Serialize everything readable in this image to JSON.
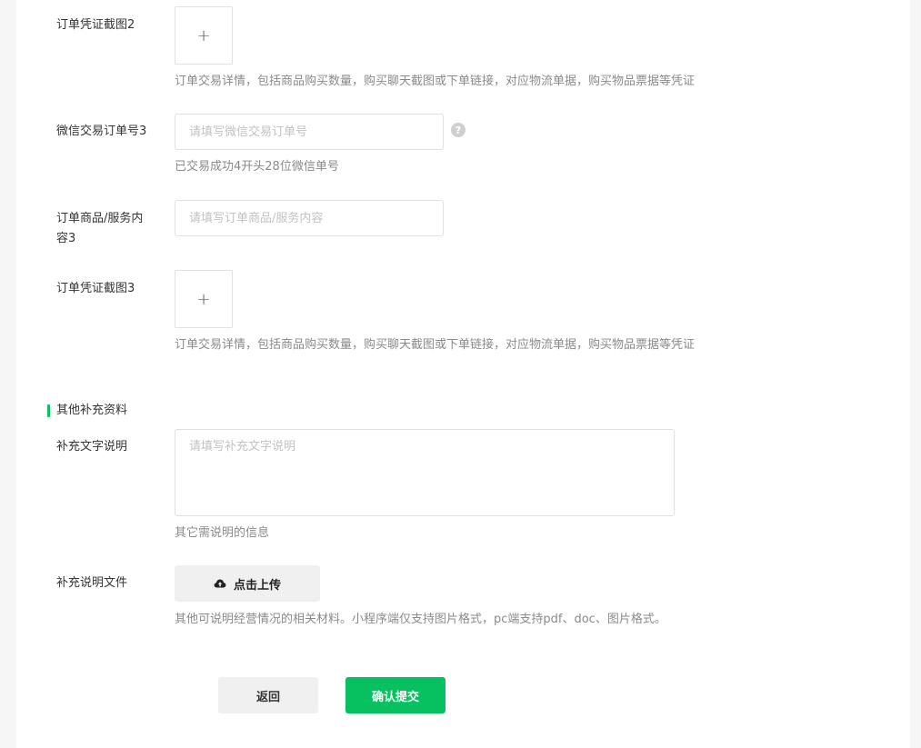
{
  "form": {
    "screenshot2": {
      "label": "订单凭证截图2",
      "upload_symbol": "+",
      "hint": "订单交易详情，包括商品购买数量，购买聊天截图或下单链接，对应物流单据，购买物品票据等凭证"
    },
    "wechat_order3": {
      "label": "微信交易订单号3",
      "placeholder": "请填写微信交易订单号",
      "value": "",
      "help_symbol": "?",
      "hint": "已交易成功4开头28位微信单号"
    },
    "goods3": {
      "label_line1": "订单商品/服务内",
      "label_line2": "容3",
      "placeholder": "请填写订单商品/服务内容",
      "value": ""
    },
    "screenshot3": {
      "label": "订单凭证截图3",
      "upload_symbol": "+",
      "hint": "订单交易详情，包括商品购买数量，购买聊天截图或下单链接，对应物流单据，购买物品票据等凭证"
    }
  },
  "supplement": {
    "section_title": "其他补充资料",
    "text_desc": {
      "label": "补充文字说明",
      "placeholder": "请填写补充文字说明",
      "value": "",
      "hint": "其它需说明的信息"
    },
    "file": {
      "label": "补充说明文件",
      "button_label": "点击上传",
      "icon": "cloud-upload-icon",
      "hint": "其他可说明经营情况的相关材料。小程序端仅支持图片格式，pc端支持pdf、doc、图片格式。"
    }
  },
  "actions": {
    "back_label": "返回",
    "submit_label": "确认提交"
  },
  "colors": {
    "accent": "#07c160",
    "page_bg": "#f6f6f6",
    "card_bg": "#ffffff"
  }
}
